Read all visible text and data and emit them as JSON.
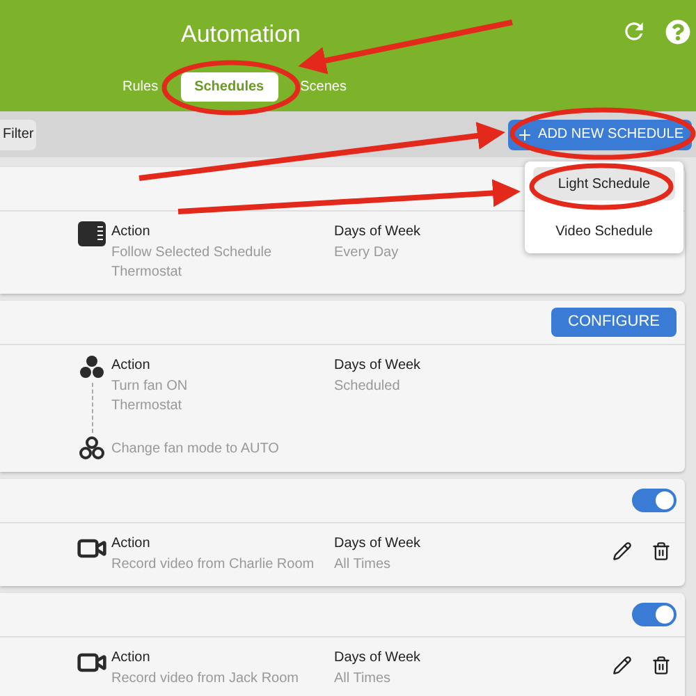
{
  "header": {
    "title": "Automation",
    "tabs": [
      {
        "label": "Rules",
        "selected": false
      },
      {
        "label": "Schedules",
        "selected": true
      },
      {
        "label": "Scenes",
        "selected": false
      }
    ]
  },
  "toolbar": {
    "filter_button": "Filter",
    "add_button": "ADD NEW SCHEDULE"
  },
  "menu": {
    "items": [
      {
        "label": "Light Schedule",
        "selected": true
      },
      {
        "label": "Video Schedule",
        "selected": false
      }
    ]
  },
  "schedules": [
    {
      "header": {
        "kind": "empty"
      },
      "steps": [
        {
          "kind": "thermostat",
          "title": "Action",
          "lines": [
            "Follow Selected Schedule",
            "Thermostat"
          ]
        }
      ],
      "days": {
        "label": "Days of Week",
        "value": "Every Day"
      }
    },
    {
      "header": {
        "kind": "button",
        "label": "CONFIGURE"
      },
      "steps": [
        {
          "kind": "fan",
          "title": "Action",
          "lines": [
            "Turn fan ON",
            "Thermostat"
          ]
        },
        {
          "kind": "fan-outline",
          "lines": [
            "Change fan mode to AUTO"
          ]
        }
      ],
      "days": {
        "label": "Days of Week",
        "value": "Scheduled"
      },
      "editable": false
    },
    {
      "header": {
        "kind": "toggle",
        "on": true
      },
      "steps": [
        {
          "kind": "video",
          "title": "Action",
          "lines": [
            "Record video from Charlie Room"
          ]
        }
      ],
      "days": {
        "label": "Days of Week",
        "value": "All Times"
      },
      "editable": true
    },
    {
      "header": {
        "kind": "toggle",
        "on": true
      },
      "steps": [
        {
          "kind": "video",
          "title": "Action",
          "lines": [
            "Record video from Jack Room"
          ]
        }
      ],
      "days": {
        "label": "Days of Week",
        "value": "All Times"
      },
      "editable": true
    }
  ]
}
